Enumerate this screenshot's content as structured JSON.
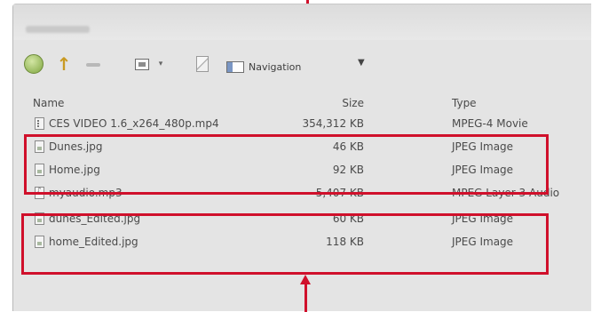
{
  "toolbar": {
    "navigation_label": "Navigation"
  },
  "columns": {
    "name": "Name",
    "size": "Size",
    "type": "Type"
  },
  "files": [
    {
      "name": "CES VIDEO 1.6_x264_480p.mp4",
      "size": "354,312 KB",
      "type": "MPEG-4 Movie",
      "icon": "video-file-icon"
    },
    {
      "name": "Dunes.jpg",
      "size": "46 KB",
      "type": "JPEG Image",
      "icon": "image-file-icon"
    },
    {
      "name": "Home.jpg",
      "size": "92 KB",
      "type": "JPEG Image",
      "icon": "image-file-icon"
    },
    {
      "name": "myaudio.mp3",
      "size": "5,407 KB",
      "type": "MPEG Layer 3 Audio",
      "icon": "audio-file-icon"
    },
    {
      "name": "dunes_Edited.jpg",
      "size": "60 KB",
      "type": "JPEG Image",
      "icon": "image-file-icon"
    },
    {
      "name": "home_Edited.jpg",
      "size": "118 KB",
      "type": "JPEG Image",
      "icon": "image-file-icon"
    }
  ],
  "annotation_color": "#d0102b"
}
